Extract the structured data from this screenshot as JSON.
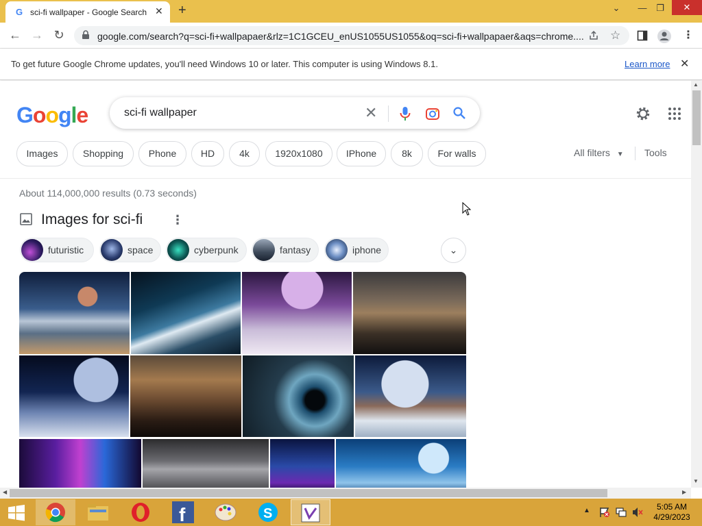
{
  "browser": {
    "tab_title": "sci-fi wallpaper - Google Search",
    "url": "google.com/search?q=sci-fi+wallpapaer&rlz=1C1GCEU_enUS1055US1055&oq=sci-fi+wallpapaer&aqs=chrome...."
  },
  "infobar": {
    "message": "To get future Google Chrome updates, you'll need Windows 10 or later. This computer is using Windows 8.1.",
    "learn_more": "Learn more"
  },
  "google": {
    "logo": "Google",
    "query": "sci-fi wallpaper",
    "filter_chips": [
      "Images",
      "Shopping",
      "Phone",
      "HD",
      "4k",
      "1920x1080",
      "IPhone",
      "8k",
      "For walls"
    ],
    "all_filters": "All filters",
    "tools": "Tools",
    "results_stats": "About 114,000,000 results (0.73 seconds)",
    "images_heading": "Images for sci-fi",
    "related_chips": [
      "futuristic",
      "space",
      "cyberpunk",
      "fantasy",
      "iphone"
    ]
  },
  "taskbar": {
    "time": "5:05 AM",
    "date": "4/29/2023",
    "apps": [
      "start-button",
      "chrome-icon",
      "file-explorer-icon",
      "opera-icon",
      "facebook-icon",
      "paint-icon",
      "skype-icon",
      "visual-studio-icon"
    ]
  },
  "colors": {
    "titlebar": "#eac04d",
    "taskbar": "#d9a43a",
    "link_blue": "#1a57c8"
  }
}
